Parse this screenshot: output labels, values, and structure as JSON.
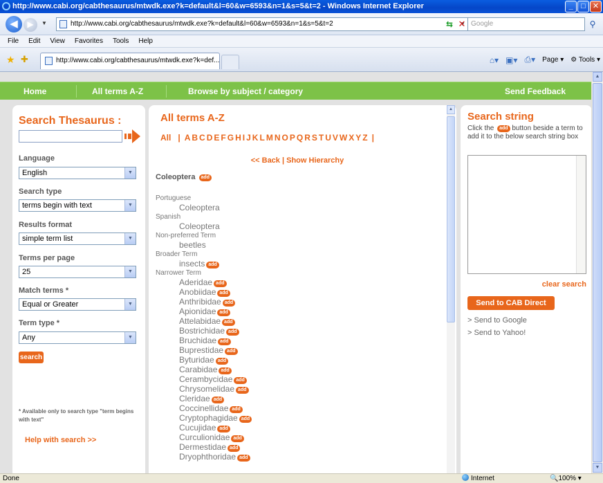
{
  "window": {
    "title": "http://www.cabi.org/cabthesaurus/mtwdk.exe?k=default&l=60&w=6593&n=1&s=5&t=2 - Windows Internet Explorer"
  },
  "address": {
    "url": "http://www.cabi.org/cabthesaurus/mtwdk.exe?k=default&l=60&w=6593&n=1&s=5&t=2",
    "search_placeholder": "Google"
  },
  "menu": [
    "File",
    "Edit",
    "View",
    "Favorites",
    "Tools",
    "Help"
  ],
  "tab": {
    "label": "http://www.cabi.org/cabthesaurus/mtwdk.exe?k=def..."
  },
  "toolbar": {
    "page_label": "Page",
    "tools_label": "Tools"
  },
  "nav": {
    "home": "Home",
    "all_terms": "All terms A-Z",
    "browse": "Browse by subject / category",
    "feedback": "Send Feedback"
  },
  "left": {
    "title": "Search Thesaurus :",
    "language_label": "Language",
    "language_value": "English",
    "search_type_label": "Search type",
    "search_type_value": "terms begin with text",
    "results_format_label": "Results format",
    "results_format_value": "simple term list",
    "terms_per_page_label": "Terms per page",
    "terms_per_page_value": "25",
    "match_terms_label": "Match terms *",
    "match_terms_value": "Equal or Greater",
    "term_type_label": "Term type *",
    "term_type_value": "Any",
    "search_button": "search",
    "note": "* Available only to search type \"term begins with text\"",
    "help_link": "Help with search >>"
  },
  "middle": {
    "title": "All terms A-Z",
    "all_label": "All",
    "letters": [
      "A",
      "B",
      "C",
      "D",
      "E",
      "F",
      "G",
      "H",
      "I",
      "J",
      "K",
      "L",
      "M",
      "N",
      "O",
      "P",
      "Q",
      "R",
      "S",
      "T",
      "U",
      "V",
      "W",
      "X",
      "Y",
      "Z"
    ],
    "back_link": "<< Back",
    "hierarchy_link": "Show Hierarchy",
    "term": "Coleoptera",
    "add_label": "add",
    "relations": [
      {
        "type": "Portuguese",
        "terms": [
          {
            "name": "Coleoptera",
            "add": false
          }
        ]
      },
      {
        "type": "Spanish",
        "terms": [
          {
            "name": "Coleoptera",
            "add": false
          }
        ]
      },
      {
        "type": "Non-preferred Term",
        "terms": [
          {
            "name": "beetles",
            "add": false
          }
        ]
      },
      {
        "type": "Broader Term",
        "terms": [
          {
            "name": "insects",
            "add": true
          }
        ]
      },
      {
        "type": "Narrower Term",
        "terms": [
          {
            "name": "Aderidae",
            "add": true
          },
          {
            "name": "Anobiidae",
            "add": true
          },
          {
            "name": "Anthribidae",
            "add": true
          },
          {
            "name": "Apionidae",
            "add": true
          },
          {
            "name": "Attelabidae",
            "add": true
          },
          {
            "name": "Bostrichidae",
            "add": true
          },
          {
            "name": "Bruchidae",
            "add": true
          },
          {
            "name": "Buprestidae",
            "add": true
          },
          {
            "name": "Byturidae",
            "add": true
          },
          {
            "name": "Carabidae",
            "add": true
          },
          {
            "name": "Cerambycidae",
            "add": true
          },
          {
            "name": "Chrysomelidae",
            "add": true
          },
          {
            "name": "Cleridae",
            "add": true
          },
          {
            "name": "Coccinellidae",
            "add": true
          },
          {
            "name": "Cryptophagidae",
            "add": true
          },
          {
            "name": "Cucujidae",
            "add": true
          },
          {
            "name": "Curculionidae",
            "add": true
          },
          {
            "name": "Dermestidae",
            "add": true
          },
          {
            "name": "Dryophthoridae",
            "add": true
          }
        ]
      }
    ]
  },
  "right": {
    "title": "Search string",
    "hint_before": "Click the",
    "hint_after": "button beside a term to add it to the below search string box",
    "clear": "clear search",
    "send_cab": "Send to CAB Direct",
    "send_google": "> Send to Google",
    "send_yahoo": "> Send to Yahoo!"
  },
  "status": {
    "left": "Done",
    "zone": "Internet",
    "zoom": "100%"
  }
}
